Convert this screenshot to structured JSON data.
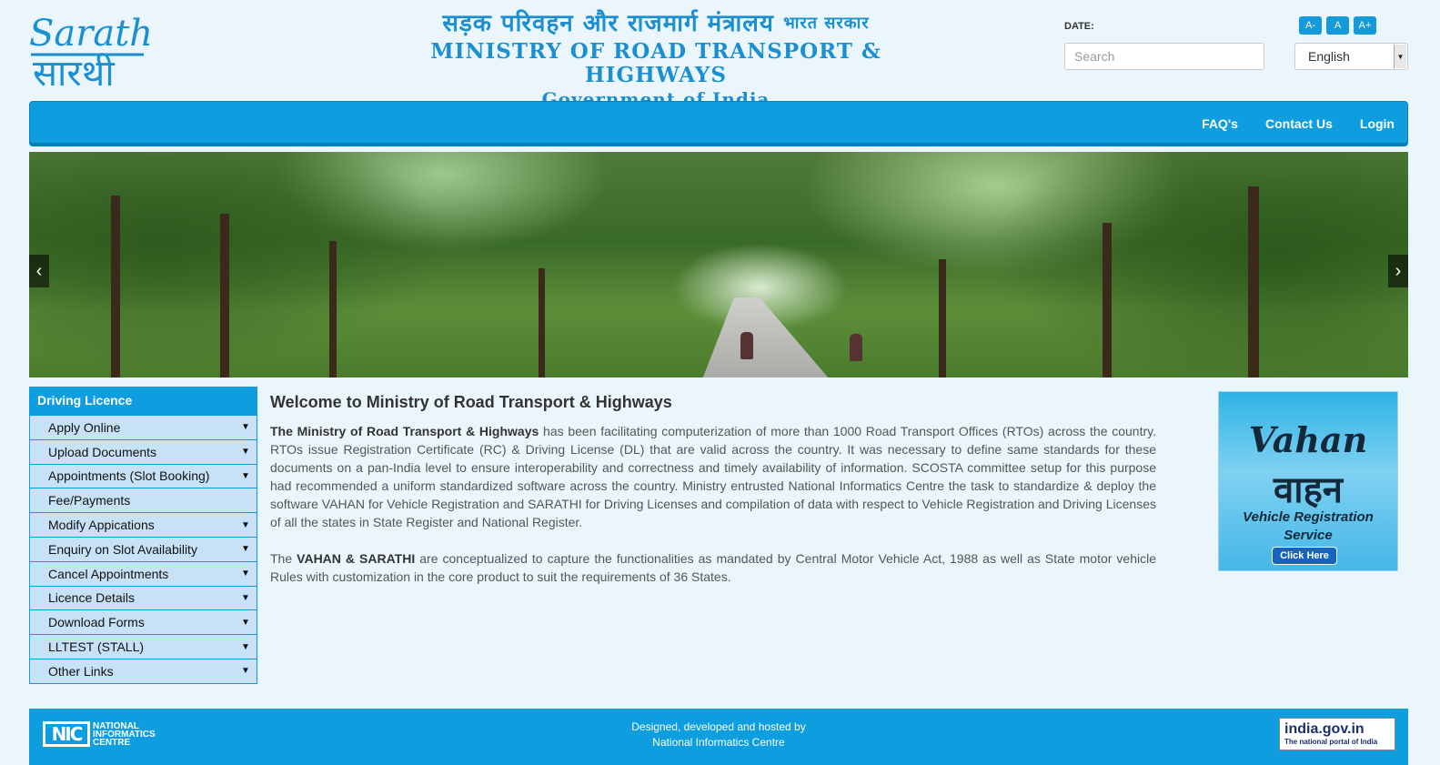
{
  "header": {
    "logo_en": "Sarathi",
    "logo_hi": "सारथी",
    "ministry_hindi": "सड़क परिवहन और राजमार्ग मंत्रालय",
    "ministry_hindi_small": "भारत सरकार",
    "ministry_english": "MINISTRY OF ROAD TRANSPORT & HIGHWAYS",
    "government": "Government of India",
    "date_label": "DATE:",
    "search_placeholder": "Search",
    "font_buttons": [
      "A-",
      "A",
      "A+"
    ],
    "language": "English"
  },
  "navbar": {
    "links": [
      "FAQ's",
      "Contact Us",
      "Login"
    ]
  },
  "carousel": {
    "prev": "‹",
    "next": "›"
  },
  "sidebar": {
    "title": "Driving Licence",
    "items": [
      {
        "label": "Apply Online",
        "expandable": true
      },
      {
        "label": "Upload Documents",
        "expandable": true
      },
      {
        "label": "Appointments (Slot Booking)",
        "expandable": true
      },
      {
        "label": "Fee/Payments",
        "expandable": false
      },
      {
        "label": "Modify Appications",
        "expandable": true
      },
      {
        "label": "Enquiry on Slot Availability",
        "expandable": true
      },
      {
        "label": "Cancel Appointments",
        "expandable": true
      },
      {
        "label": "Licence Details",
        "expandable": true
      },
      {
        "label": "Download Forms",
        "expandable": true
      },
      {
        "label": "LLTEST (STALL)",
        "expandable": true
      },
      {
        "label": "Other Links",
        "expandable": true
      }
    ]
  },
  "content": {
    "heading": "Welcome to Ministry of Road Transport & Highways",
    "p1_bold": "The Ministry of Road Transport & Highways",
    "p1_text": " has been facilitating computerization of more than 1000 Road Transport Offices (RTOs) across the country. RTOs issue Registration Certificate (RC) & Driving License (DL) that are valid across the country. It was necessary to define same standards for these documents on a pan-India level to ensure interoperability and correctness and timely availability of information. SCOSTA committee setup for this purpose had recommended a uniform standardized software across the country. Ministry entrusted National Informatics Centre the task to standardize & deploy the software VAHAN for Vehicle Registration and SARATHI for Driving Licenses and compilation of data with respect to Vehicle Registration and Driving Licenses of all the states in State Register and National Register.",
    "p2_pre": "The ",
    "p2_bold": "VAHAN & SARATHI",
    "p2_text": " are conceptualized to capture the functionalities as mandated by Central Motor Vehicle Act, 1988 as well as State motor vehicle Rules with customization in the core product to suit the requirements of 36 States."
  },
  "vahan_ad": {
    "title_en": "Vahan",
    "title_hi": "वाहन",
    "subtitle": "Vehicle Registration Service",
    "button": "Click Here"
  },
  "footer": {
    "nic_short": "NIC",
    "nic_full": "NATIONAL INFORMATICS CENTRE",
    "designed_by": "Designed, developed and hosted by",
    "org": "National Informatics Centre",
    "india_portal": "india.gov.in",
    "india_tagline": "The national portal of India"
  },
  "colors": {
    "accent": "#0e9ee0",
    "sidebar_item_bg": "#c7e2f6",
    "page_bg": "#eaf6fc"
  }
}
